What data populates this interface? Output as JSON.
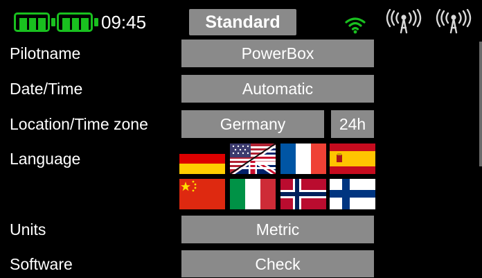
{
  "status_bar": {
    "time": "09:45",
    "mode_button": "Standard",
    "battery_color": "#19c01f",
    "wifi_color": "#19c01f",
    "icons": [
      "battery-icon",
      "battery-icon",
      "wifi-icon",
      "antenna-icon",
      "antenna-icon"
    ]
  },
  "settings": {
    "pilotname": {
      "label": "Pilotname",
      "value": "PowerBox"
    },
    "datetime": {
      "label": "Date/Time",
      "value": "Automatic"
    },
    "location": {
      "label": "Location/Time zone",
      "value": "Germany",
      "format": "24h"
    },
    "language": {
      "label": "Language",
      "flags": [
        "German",
        "English",
        "French",
        "Spanish",
        "Chinese",
        "Italian",
        "Norwegian",
        "Finnish"
      ]
    },
    "units": {
      "label": "Units",
      "value": "Metric"
    },
    "software": {
      "label": "Software",
      "value": "Check"
    }
  },
  "colors": {
    "background": "#000000",
    "button": "#8a8a8a",
    "text": "#ffffff",
    "accent_green": "#19c01f"
  }
}
